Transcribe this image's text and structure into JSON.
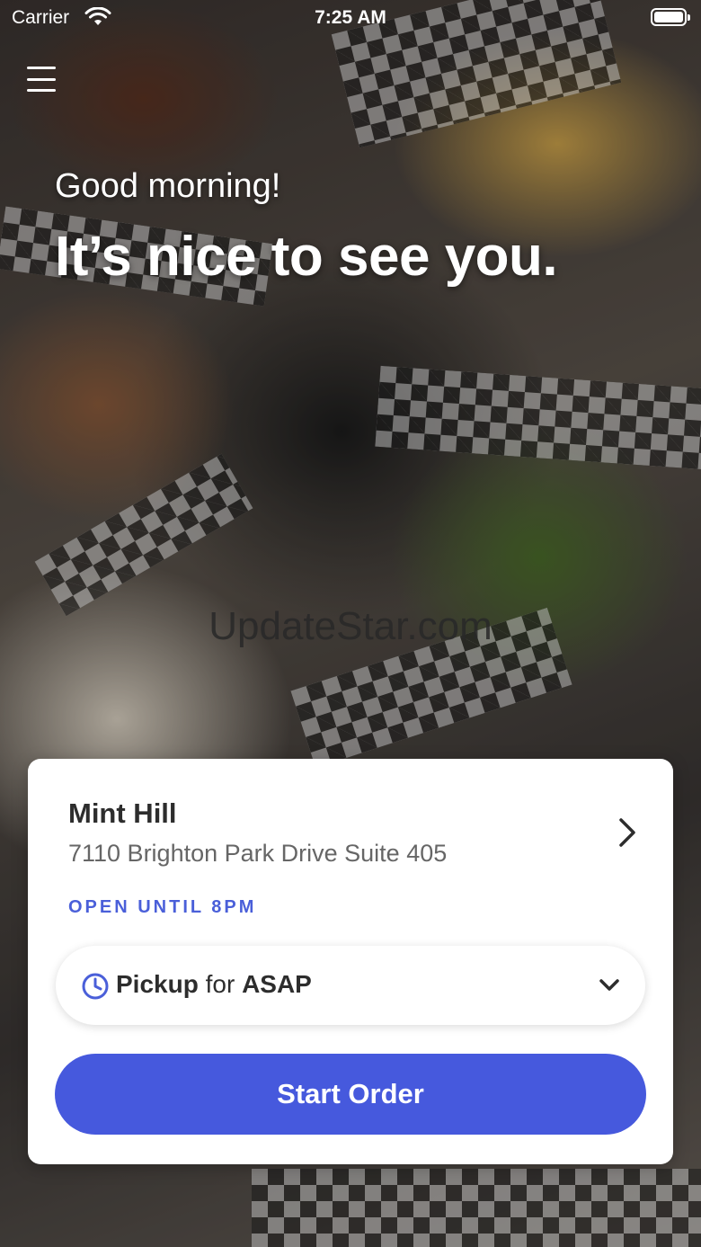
{
  "status_bar": {
    "carrier": "Carrier",
    "time": "7:25 AM"
  },
  "hero": {
    "greeting": "Good morning!",
    "headline": "It’s nice to see you.",
    "watermark": "UpdateStar.com"
  },
  "location_card": {
    "name": "Mint Hill",
    "address": "7110 Brighton Park Drive  Suite 405",
    "open_status": "OPEN UNTIL 8PM",
    "pickup": {
      "mode": "Pickup",
      "connector": "for",
      "time": "ASAP"
    },
    "start_button": "Start Order"
  },
  "colors": {
    "accent": "#4659dd",
    "status_text": "#4a5fd9"
  },
  "icons": {
    "menu": "hamburger-menu-icon",
    "wifi": "wifi-icon",
    "battery": "battery-icon",
    "chevron_right": "chevron-right-icon",
    "clock": "clock-icon",
    "chevron_down": "chevron-down-icon"
  }
}
